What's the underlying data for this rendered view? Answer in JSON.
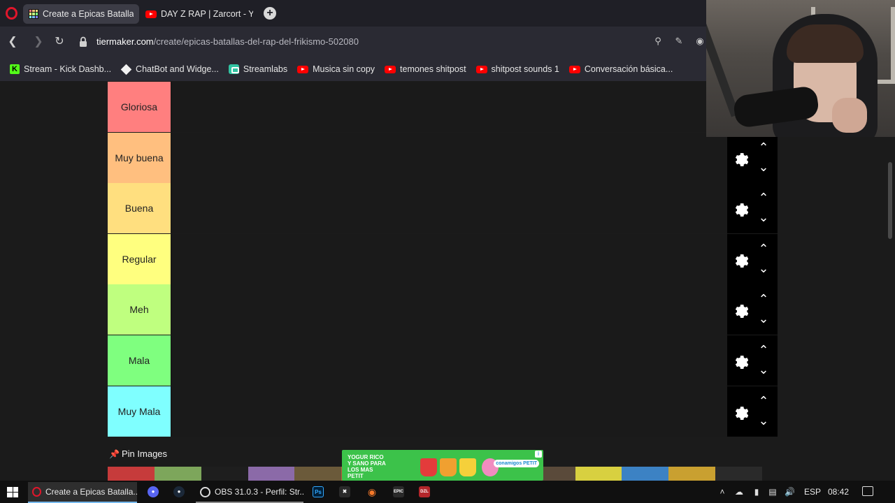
{
  "browser": {
    "tabs": [
      {
        "title": "Create a Epicas Batallas de",
        "active": true
      },
      {
        "title": "DAY Z RAP | Zarcort - You",
        "active": false
      }
    ],
    "url": {
      "host": "tiermaker.com",
      "path": "/create/epicas-batallas-del-rap-del-frikismo-502080"
    },
    "bookmarks": [
      {
        "label": "Stream - Kick Dashb...",
        "icon": "kick-icon"
      },
      {
        "label": "ChatBot and Widge...",
        "icon": "diamond-icon"
      },
      {
        "label": "Streamlabs",
        "icon": "streamlabs-icon"
      },
      {
        "label": "Musica sin copy",
        "icon": "youtube-icon"
      },
      {
        "label": "temones shitpost",
        "icon": "youtube-icon"
      },
      {
        "label": "shitpost sounds 1",
        "icon": "youtube-icon"
      },
      {
        "label": "Conversación básica...",
        "icon": "youtube-icon"
      }
    ]
  },
  "tiers": [
    {
      "label": "Gloriosa",
      "color": "#ff7f7f"
    },
    {
      "label": "Muy buena",
      "color": "#ffbf7f"
    },
    {
      "label": "Buena",
      "color": "#ffdf7f"
    },
    {
      "label": "Regular",
      "color": "#ffff7f"
    },
    {
      "label": "Meh",
      "color": "#bfff7f"
    },
    {
      "label": "Mala",
      "color": "#7fff7f"
    },
    {
      "label": "Muy Mala",
      "color": "#7fffff"
    }
  ],
  "pin": {
    "label": "Pin Images"
  },
  "ad": {
    "text": "YOGUR RICO Y SANO PARA LOS MAS PETIT",
    "brand": "conamigos PETIT"
  },
  "taskbar": {
    "apps": [
      {
        "label": "Create a Epicas Batalla...",
        "icon": "opera-icon"
      },
      {
        "label": "OBS 31.0.3 - Perfil: Str...",
        "icon": "obs-icon"
      }
    ],
    "language": "ESP",
    "clock": "08:42"
  },
  "colors": {
    "accent": "#76b9ed",
    "opera": "#e0162b",
    "youtube": "#ff0000",
    "kick": "#53fc18"
  }
}
